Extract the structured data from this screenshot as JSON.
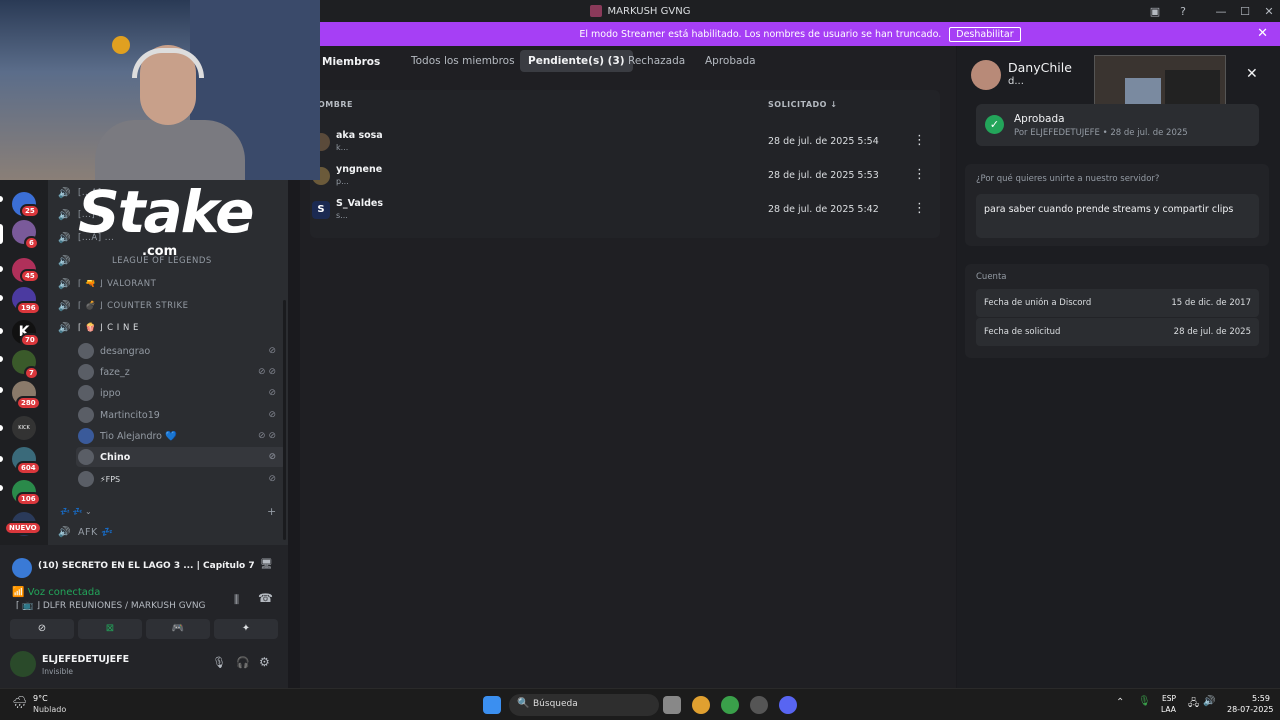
{
  "window": {
    "title": "MARKUSH GVNG"
  },
  "banner": {
    "text": "El modo Streamer está habilitado. Los nombres de usuario se han truncado.",
    "button": "Deshabilitar"
  },
  "tabs": [
    "Miembros",
    "Todos los miembros",
    "Pendiente(s) (3)",
    "Rechazada",
    "Aprobada"
  ],
  "table": {
    "col_name": "OMBRE",
    "col_date": "SOLICITADO",
    "rows": [
      {
        "name": "aka sosa",
        "sub": "k...",
        "date": "28 de jul. de 2025 5:54"
      },
      {
        "name": "yngnene",
        "sub": "p...",
        "date": "28 de jul. de 2025 5:53"
      },
      {
        "name": "S_Valdes",
        "sub": "s...",
        "date": "28 de jul. de 2025 5:42"
      }
    ]
  },
  "profile": {
    "name": "DanyChile",
    "handle": "d...",
    "status": "Aprobada",
    "by": "Por ELJEFEDETUJEFE",
    "by_date": "28 de jul. de 2025",
    "question": "¿Por qué quieres unirte a nuestro servidor?",
    "answer": "para saber cuando prende streams y compartir clips",
    "account_title": "Cuenta",
    "join_label": "Fecha de unión a Discord",
    "join_value": "15 de dic. de 2017",
    "req_label": "Fecha de solicitud",
    "req_value": "28 de jul. de 2025"
  },
  "channels": [
    {
      "label": "[...A] ..."
    },
    {
      "label": "[...] ..."
    },
    {
      "label": "[...A] ..."
    },
    {
      "label": "LEAGUE OF LEGENDS"
    },
    {
      "label": "VALORANT"
    },
    {
      "label": "COUNTER STRIKE"
    },
    {
      "label": "C I N E"
    }
  ],
  "voice_users": [
    "desangrao",
    "faze_z",
    "ippo",
    "Martincito19",
    "Tio Alejandro 💙",
    "Chino",
    "⚡FPS"
  ],
  "afk": "AFK 💤",
  "activity": "(10) SECRETO EN EL LAGO 3 ... | Capítulo 7 ...",
  "voice": {
    "status": "Voz conectada",
    "channel": "DLFR REUNIONES / MARKUSH GVNG"
  },
  "me": {
    "name": "ELJEFEDETUJEFE",
    "status": "Invisible"
  },
  "servers": [
    {
      "badge": "25"
    },
    {
      "badge": "6"
    },
    {
      "badge": "45"
    },
    {
      "badge": "196"
    },
    {
      "badge": "70"
    },
    {
      "badge": "7"
    },
    {
      "badge": "280"
    },
    {
      "badge": ""
    },
    {
      "badge": "604"
    },
    {
      "badge": "106"
    }
  ],
  "new_badge": "NUEVO",
  "sponsor": {
    "logo": "Stake",
    "domain": ".com"
  },
  "taskbar": {
    "weather_temp": "9°C",
    "weather_desc": "Nublado",
    "search": "Búsqueda",
    "lang1": "ESP",
    "lang2": "LAA",
    "time": "5:59",
    "date": "28-07-2025"
  }
}
